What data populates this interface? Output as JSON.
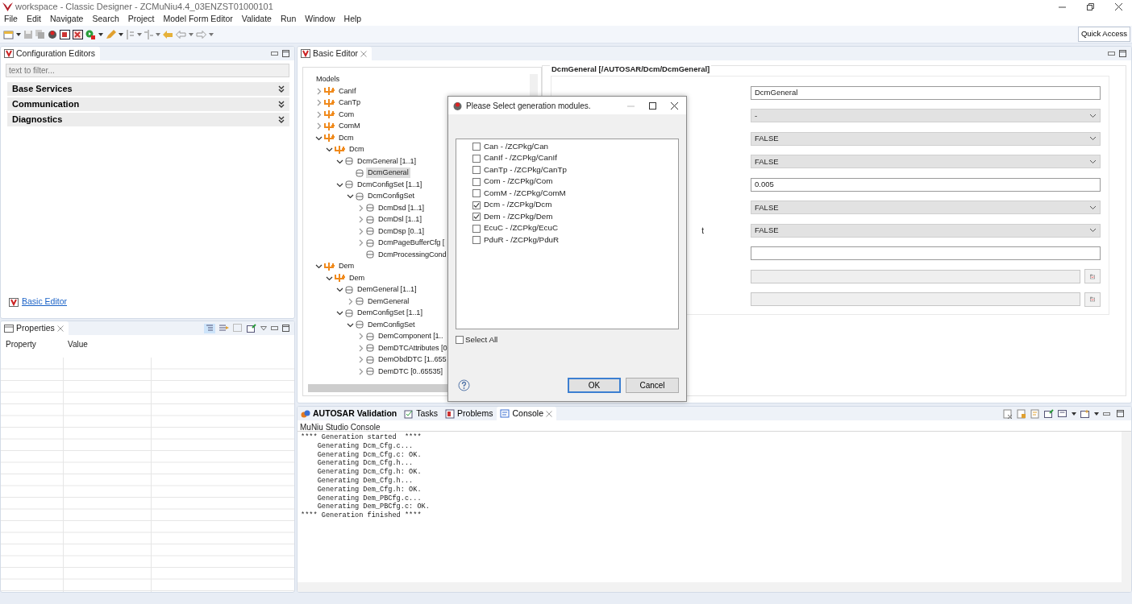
{
  "window": {
    "title": "workspace - Classic Designer - ZCMuNiu4.4_03ENZST01000101"
  },
  "menu": [
    "File",
    "Edit",
    "Navigate",
    "Search",
    "Project",
    "Model Form Editor",
    "Validate",
    "Run",
    "Window",
    "Help"
  ],
  "toolbar": {
    "quick_access": "Quick Access"
  },
  "config_editors": {
    "tab": "Configuration Editors",
    "filter": {
      "placeholder": "text to filter..."
    },
    "sections": [
      {
        "label": "Base Services",
        "expanded": false
      },
      {
        "label": "Communication",
        "expanded": false
      },
      {
        "label": "Diagnostics",
        "expanded": false
      }
    ],
    "link": "Basic Editor"
  },
  "properties": {
    "tab": "Properties",
    "columns": [
      "Property",
      "Value"
    ]
  },
  "editor": {
    "tab": "Basic Editor",
    "tree": {
      "header": "Models",
      "items": [
        {
          "label": "CanIf",
          "kind": "module",
          "expanded": false,
          "selected": false
        },
        {
          "label": "CanTp",
          "kind": "module",
          "expanded": false,
          "selected": false
        },
        {
          "label": "Com",
          "kind": "module",
          "expanded": false,
          "selected": false
        },
        {
          "label": "ComM",
          "kind": "module",
          "expanded": false,
          "selected": false
        },
        {
          "label": "Dcm",
          "kind": "module",
          "expanded": true,
          "selected": false,
          "children": [
            {
              "label": "Dcm",
              "kind": "module",
              "expanded": true,
              "selected": false,
              "children": [
                {
                  "label": "DcmGeneral [1..1]",
                  "kind": "container",
                  "expanded": true,
                  "selected": false,
                  "children": [
                    {
                      "label": "DcmGeneral",
                      "kind": "container",
                      "selected": true
                    }
                  ]
                },
                {
                  "label": "DcmConfigSet [1..1]",
                  "kind": "container",
                  "expanded": true,
                  "selected": false,
                  "children": [
                    {
                      "label": "DcmConfigSet",
                      "kind": "container",
                      "expanded": true,
                      "selected": false,
                      "children": [
                        {
                          "label": "DcmDsd [1..1]",
                          "kind": "container",
                          "expanded": false,
                          "selected": false
                        },
                        {
                          "label": "DcmDsl [1..1]",
                          "kind": "container",
                          "expanded": false,
                          "selected": false
                        },
                        {
                          "label": "DcmDsp [0..1]",
                          "kind": "container",
                          "expanded": false,
                          "selected": false
                        },
                        {
                          "label": "DcmPageBufferCfg [",
                          "kind": "container",
                          "expanded": false,
                          "selected": false
                        },
                        {
                          "label": "DcmProcessingCond",
                          "kind": "container",
                          "selected": false
                        }
                      ]
                    }
                  ]
                }
              ]
            }
          ]
        },
        {
          "label": "Dem",
          "kind": "module",
          "expanded": true,
          "selected": false,
          "children": [
            {
              "label": "Dem",
              "kind": "module",
              "expanded": true,
              "selected": false,
              "children": [
                {
                  "label": "DemGeneral [1..1]",
                  "kind": "container",
                  "expanded": true,
                  "selected": false,
                  "children": [
                    {
                      "label": "DemGeneral",
                      "kind": "container",
                      "expanded": false,
                      "selected": false
                    }
                  ]
                },
                {
                  "label": "DemConfigSet [1..1]",
                  "kind": "container",
                  "expanded": true,
                  "selected": false,
                  "children": [
                    {
                      "label": "DemConfigSet",
                      "kind": "container",
                      "expanded": true,
                      "selected": false,
                      "children": [
                        {
                          "label": "DemComponent [1..",
                          "kind": "container",
                          "expanded": false,
                          "selected": false
                        },
                        {
                          "label": "DemDTCAttributes [0",
                          "kind": "container",
                          "expanded": false,
                          "selected": false
                        },
                        {
                          "label": "DemObdDTC [1..655",
                          "kind": "container",
                          "expanded": false,
                          "selected": false
                        },
                        {
                          "label": "DemDTC [0..65535]",
                          "kind": "container",
                          "expanded": false,
                          "selected": false
                        }
                      ]
                    }
                  ]
                }
              ]
            }
          ]
        }
      ]
    },
    "form": {
      "title": "DcmGeneral [/AUTOSAR/Dcm/DcmGeneral]",
      "rows": [
        {
          "kind": "text",
          "value": "DcmGeneral"
        },
        {
          "kind": "select",
          "value": "-"
        },
        {
          "kind": "select",
          "value": "FALSE"
        },
        {
          "kind": "select",
          "value": "FALSE"
        },
        {
          "kind": "text",
          "value": "0.005"
        },
        {
          "kind": "select",
          "value": "FALSE"
        },
        {
          "kind": "select",
          "value": "FALSE",
          "label": "t"
        },
        {
          "kind": "text"
        },
        {
          "kind": "browse"
        },
        {
          "kind": "browse"
        }
      ]
    }
  },
  "dialog": {
    "title": "Please Select generation modules.",
    "modules": [
      {
        "label": "Can - /ZCPkg/Can",
        "checked": false
      },
      {
        "label": "CanIf - /ZCPkg/CanIf",
        "checked": false
      },
      {
        "label": "CanTp - /ZCPkg/CanTp",
        "checked": false
      },
      {
        "label": "Com - /ZCPkg/Com",
        "checked": false
      },
      {
        "label": "ComM - /ZCPkg/ComM",
        "checked": false
      },
      {
        "label": "Dcm - /ZCPkg/Dcm",
        "checked": true
      },
      {
        "label": "Dem - /ZCPkg/Dem",
        "checked": true
      },
      {
        "label": "EcuC - /ZCPkg/EcuC",
        "checked": false
      },
      {
        "label": "PduR - /ZCPkg/PduR",
        "checked": false
      }
    ],
    "select_all": {
      "label": "Select All",
      "checked": false
    },
    "buttons": [
      {
        "label": "OK",
        "default": true
      },
      {
        "label": "Cancel",
        "default": false
      }
    ]
  },
  "console_view": {
    "tabs": [
      {
        "label": "AUTOSAR Validation",
        "selected": false
      },
      {
        "label": "Tasks",
        "selected": false
      },
      {
        "label": "Problems",
        "selected": false
      },
      {
        "label": "Console",
        "selected": true
      }
    ],
    "title": "MuNiu Studio Console",
    "lines": [
      "**** Generation started  ****",
      "    Generating Dcm_Cfg.c...",
      "    Generating Dcm_Cfg.c: OK.",
      "    Generating Dcm_Cfg.h...",
      "    Generating Dcm_Cfg.h: OK.",
      "    Generating Dem_Cfg.h...",
      "    Generating Dem_Cfg.h: OK.",
      "    Generating Dem_PBCfg.c...",
      "    Generating Dem_PBCfg.c: OK.",
      "**** Generation finished ****"
    ]
  }
}
